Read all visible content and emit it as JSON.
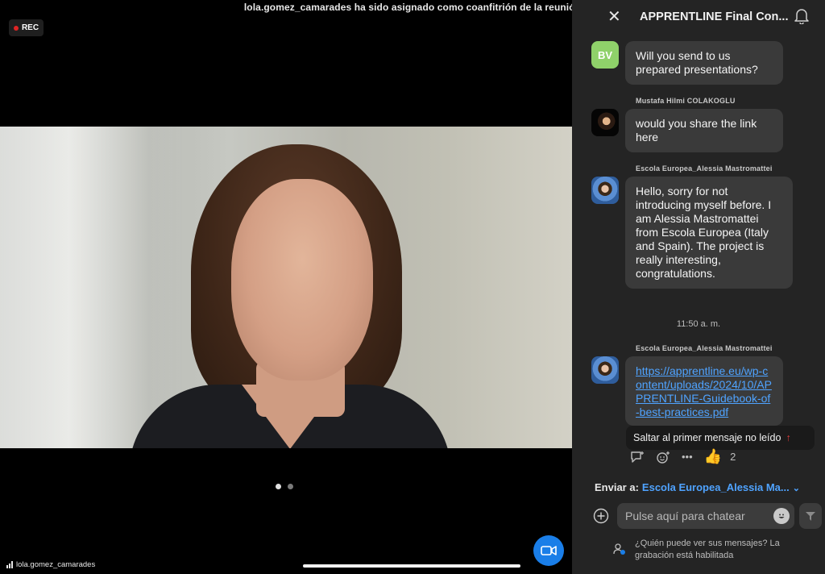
{
  "notification": {
    "text": "lola.gomez_camarades ha sido asignado como coanfitrión de la reunión"
  },
  "recording": {
    "label": "REC"
  },
  "video": {
    "self_name": "lola.gomez_camarades"
  },
  "pager": {
    "pages": 2,
    "active": 0
  },
  "chat": {
    "title": "APPRENTLINE Final Con...",
    "messages": [
      {
        "sender": "",
        "avatar_text": "BV",
        "avatar": "initials",
        "text": "Will you send to us prepared presentations?"
      },
      {
        "sender": "Mustafa Hilmi COLAKOGLU",
        "avatar": "photo",
        "text": "would you share the link here"
      },
      {
        "sender": "Escola Europea_Alessia Mastromattei",
        "avatar": "photo",
        "text": "Hello, sorry for not introducing myself before. I am Alessia Mastromattei from Escola Europea (Italy and Spain). The project is really interesting, congratulations."
      },
      {
        "sender": "Escola Europea_Alessia Mastromattei",
        "avatar": "photo",
        "text": "https://apprentline.eu/wp-content/uploads/2024/10/APPRENTLINE-Guidebook-of-best-practices.pdf"
      }
    ],
    "time_separator": "11:50 a. m.",
    "jump_unread": "Saltar al primer mensaje no leído",
    "reaction": {
      "emoji": "👍",
      "count": "2"
    },
    "send_to_label": "Enviar a:",
    "send_to_recipient": "Escola Europea_Alessia Ma...",
    "input_placeholder": "Pulse aquí para chatear",
    "privacy_note": "¿Quién puede ver sus mensajes? La grabación está habilitada"
  },
  "colors": {
    "accent": "#1a7ee8",
    "link": "#4fa3ff",
    "rec": "#e02424",
    "panel": "#242424",
    "bubble": "#3a3a3a"
  },
  "icons": [
    "close-icon",
    "bell-icon",
    "reply-icon",
    "add-reaction-icon",
    "more-icon",
    "thumbs-up-icon",
    "chevron-down-icon",
    "plus-icon",
    "emoji-icon",
    "send-icon",
    "privacy-icon",
    "video-camera-icon",
    "signal-bars-icon"
  ]
}
